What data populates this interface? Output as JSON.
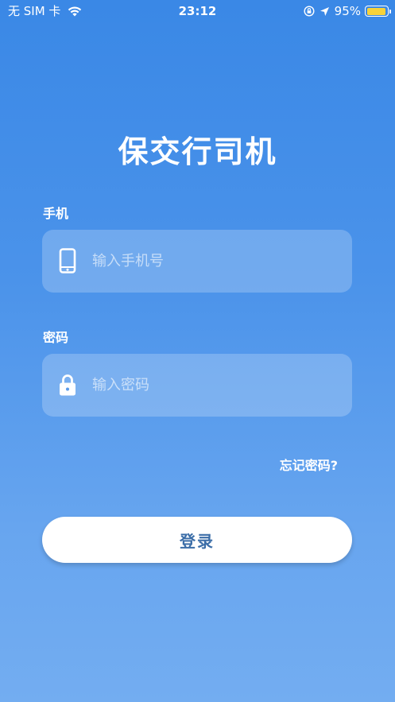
{
  "status_bar": {
    "carrier": "无 SIM 卡",
    "time": "23:12",
    "battery_percent": "95%",
    "battery_fill_fraction": 0.95,
    "battery_color": "#f7d23a",
    "icons": [
      "wifi-icon",
      "orientation-lock-icon",
      "location-arrow-icon",
      "battery-icon"
    ]
  },
  "app": {
    "title": "保交行司机"
  },
  "form": {
    "phone": {
      "label": "手机",
      "placeholder": "输入手机号",
      "value": "",
      "icon": "smartphone-icon"
    },
    "password": {
      "label": "密码",
      "placeholder": "输入密码",
      "value": "",
      "icon": "padlock-icon"
    },
    "forgot_password": "忘记密码?",
    "login_button": "登录"
  },
  "colors": {
    "background_top": "#3a88e6",
    "background_bottom": "#73adf1",
    "button_text": "#3c6ea8"
  }
}
